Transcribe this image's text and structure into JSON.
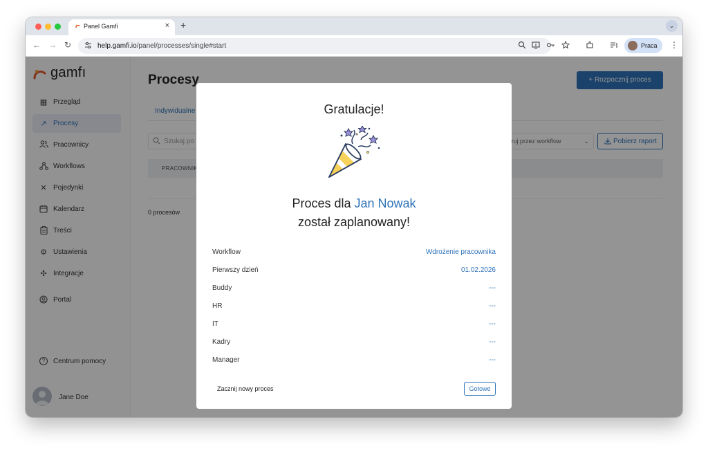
{
  "browser": {
    "tab_title": "Panel Gamfi",
    "tab_close": "×",
    "new_tab": "+",
    "tab_menu": "⌄",
    "url_domain": "help.gamfi.io",
    "url_path": "/panel/processes/single#start",
    "profile_label": "Praca",
    "back": "←",
    "forward": "→",
    "reload": "↻"
  },
  "app": {
    "logo_text": "gamfı",
    "brand_color": "#2f73b9",
    "sidebar": {
      "items": [
        {
          "label": "Przegląd",
          "icon": "grid-icon",
          "glyph": "▦"
        },
        {
          "label": "Procesy",
          "icon": "process-icon",
          "glyph": "↗",
          "active": true
        },
        {
          "label": "Pracownicy",
          "icon": "people-icon",
          "glyph": "👥"
        },
        {
          "label": "Workflows",
          "icon": "workflow-icon",
          "glyph": "⚘"
        },
        {
          "label": "Pojedynki",
          "icon": "swords-icon",
          "glyph": "✕"
        },
        {
          "label": "Kalendarz",
          "icon": "calendar-icon",
          "glyph": "▤"
        },
        {
          "label": "Treści",
          "icon": "clipboard-icon",
          "glyph": "▯"
        },
        {
          "label": "Ustawienia",
          "icon": "gear-icon",
          "glyph": "⚙"
        },
        {
          "label": "Integracje",
          "icon": "puzzle-icon",
          "glyph": "✣"
        },
        {
          "label": "Portal",
          "icon": "user-circle-icon",
          "glyph": "◉"
        }
      ],
      "help_label": "Centrum pomocy",
      "help_glyph": "?",
      "user_name": "Jane Doe"
    },
    "main": {
      "title": "Procesy",
      "start_button": "+  Rozpocznij proces",
      "tab_individual": "Indywidualne",
      "search_placeholder": "Szukaj po",
      "filter_placeholder": "…truj przez workflow",
      "report_button": "Pobierz raport",
      "table_header_employee": "PRACOWNIK",
      "count": "0 procesów"
    }
  },
  "modal": {
    "title": "Gratulacje!",
    "message_prefix": "Proces dla ",
    "employee_name": "Jan Nowak",
    "message_suffix": "został zaplanowany!",
    "rows": [
      {
        "label": "Workflow",
        "value": "Wdrożenie pracownika"
      },
      {
        "label": "Pierwszy dzień",
        "value": "01.02.2026"
      },
      {
        "label": "Buddy",
        "value": "---"
      },
      {
        "label": "HR",
        "value": "---"
      },
      {
        "label": "IT",
        "value": "---"
      },
      {
        "label": "Kadry",
        "value": "---"
      },
      {
        "label": "Manager",
        "value": "---"
      }
    ],
    "new_process_link": "Zacznij nowy proces",
    "done_button": "Gotowe"
  }
}
